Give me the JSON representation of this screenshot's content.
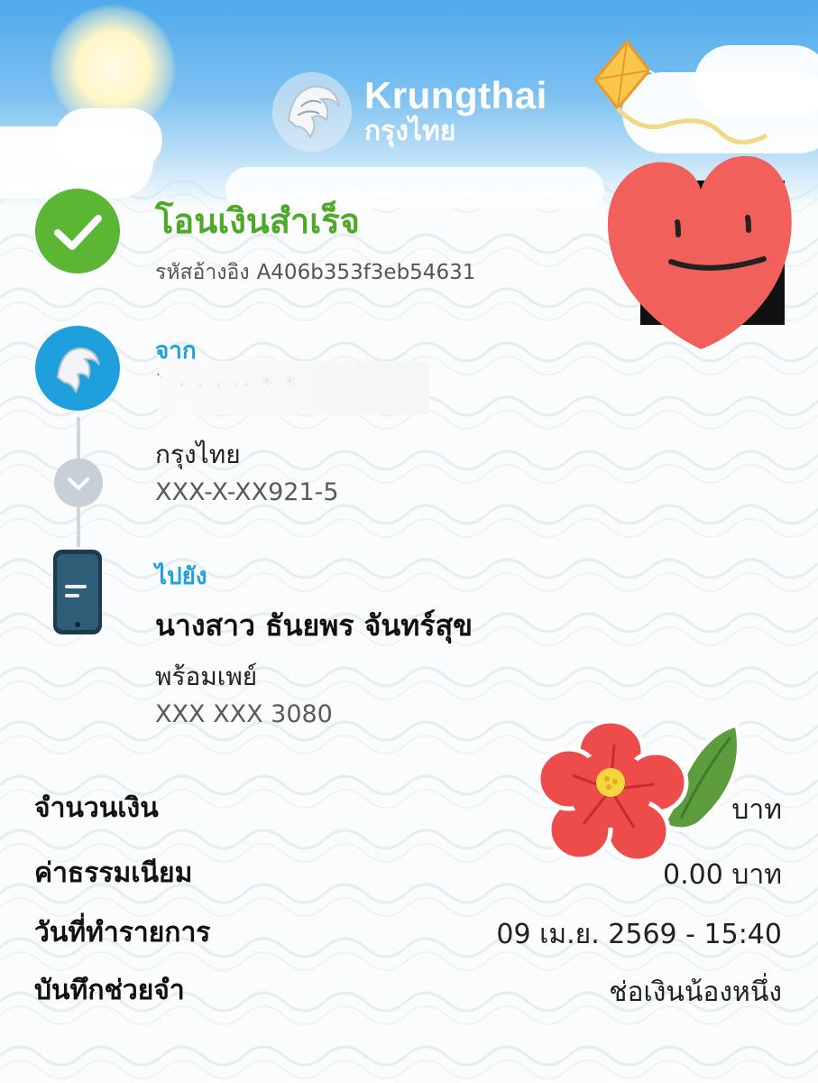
{
  "brand": {
    "name_en": "Krungthai",
    "name_th": "กรุงไทย"
  },
  "status": {
    "title": "โอนเงินสำเร็จ",
    "ref_label": "รหัสอ้างอิง",
    "ref_code": "A406b353f3eb54631"
  },
  "from": {
    "label": "จาก",
    "name_visible": "` ·  · ·           ·· * *",
    "bank": "กรุงไทย",
    "account": "XXX-X-XX921-5"
  },
  "to": {
    "label": "ไปยัง",
    "name": "นางสาว ธันยพร จันทร์สุข",
    "service": "พร้อมเพย์",
    "account": "XXX XXX 3080"
  },
  "details": [
    {
      "label": "จำนวนเงิน",
      "value": "บาท"
    },
    {
      "label": "ค่าธรรมเนียม",
      "value": "0.00 บาท"
    },
    {
      "label": "วันที่ทำรายการ",
      "value": "09 เม.ย. 2569 - 15:40"
    },
    {
      "label": "บันทึกช่วยจำ",
      "value": "ช่อเงินน้องหนึ่ง"
    }
  ],
  "colors": {
    "success": "#4fa929",
    "accent_blue": "#1fa0dc",
    "sky": "#4fa9ec",
    "heart": "#f2605c",
    "flower": "#ee4b4b"
  },
  "icons": [
    "success-check-icon",
    "krungthai-bird-icon",
    "chevron-down-icon",
    "smartphone-icon",
    "kite-icon",
    "heart-sticker-icon",
    "flower-sticker-icon"
  ]
}
